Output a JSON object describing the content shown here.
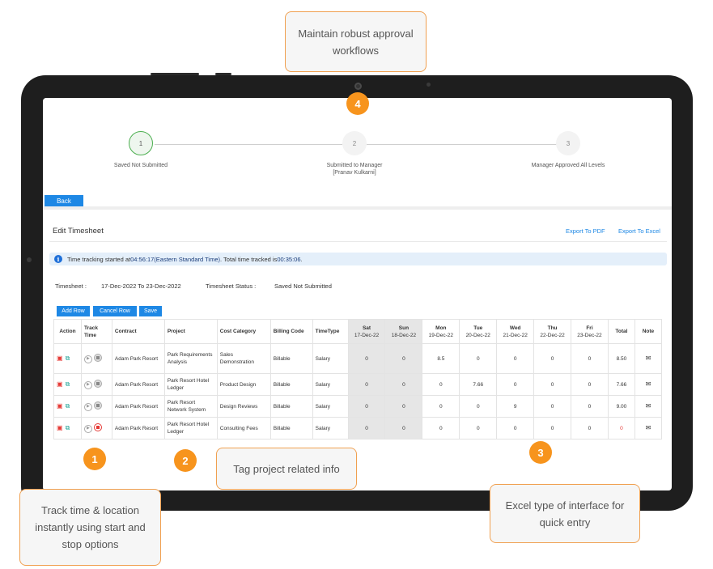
{
  "callouts": {
    "top": "Maintain robust approval workflows",
    "tag": "Tag project related info",
    "excel": "Excel type of interface for quick entry",
    "track": "Track time & location instantly using start and stop options"
  },
  "markers": {
    "m1": "1",
    "m2": "2",
    "m3": "3",
    "m4": "4"
  },
  "colors": {
    "accent": "#1e88e5",
    "marker": "#f7941d",
    "callout_border": "#f0a050",
    "step_active": "#4caf50",
    "danger": "#e53935"
  },
  "stepper": {
    "steps": [
      {
        "num": "1",
        "label": "Saved Not Submitted"
      },
      {
        "num": "2",
        "label": "Submitted to Manager",
        "sublabel": "[Pranav Kulkarni]"
      },
      {
        "num": "3",
        "label": "Manager Approved All Levels"
      }
    ]
  },
  "back_label": "Back",
  "page_title": "Edit Timesheet",
  "exports": {
    "pdf": "Export To PDF",
    "excel": "Export To Excel"
  },
  "info": {
    "icon": "info-icon",
    "prefix": "Time tracking started at ",
    "time": "04:56:17(Eastern Standard Time)",
    "middle": ". Total time tracked is ",
    "total": "00:35:06",
    "suffix": "."
  },
  "timesheet": {
    "range_label": "Timesheet :",
    "range": "17-Dec-2022 To 23-Dec-2022",
    "status_label": "Timesheet Status :",
    "status": "Saved Not Submitted"
  },
  "buttons": {
    "add_row": "Add Row",
    "cancel_row": "Cancel Row",
    "save": "Save"
  },
  "table": {
    "headers": {
      "action": "Action",
      "track": "Track Time",
      "contract": "Contract",
      "project": "Project",
      "cost": "Cost Category",
      "billing": "Billing Code",
      "timetype": "TimeType",
      "total": "Total",
      "note": "Note"
    },
    "days": [
      {
        "day": "Sat",
        "date": "17-Dec-22"
      },
      {
        "day": "Sun",
        "date": "18-Dec-22"
      },
      {
        "day": "Mon",
        "date": "19-Dec-22"
      },
      {
        "day": "Tue",
        "date": "20-Dec-22"
      },
      {
        "day": "Wed",
        "date": "21-Dec-22"
      },
      {
        "day": "Thu",
        "date": "22-Dec-22"
      },
      {
        "day": "Fri",
        "date": "23-Dec-22"
      }
    ],
    "rows": [
      {
        "contract": "Adam Park Resort",
        "project": "Park Requirements Analysis",
        "cost": "Sales Demonstration",
        "billing": "Billable",
        "timetype": "Salary",
        "hours": [
          "0",
          "0",
          "8.5",
          "0",
          "0",
          "0",
          "0"
        ],
        "total": "8.50"
      },
      {
        "contract": "Adam Park Resort",
        "project": "Park Resort Hotel Ledger",
        "cost": "Product Design",
        "billing": "Billable",
        "timetype": "Salary",
        "hours": [
          "0",
          "0",
          "0",
          "7.66",
          "0",
          "0",
          "0"
        ],
        "total": "7.66"
      },
      {
        "contract": "Adam Park Resort",
        "project": "Park Resort Network System",
        "cost": "Design Reviews",
        "billing": "Billable",
        "timetype": "Salary",
        "hours": [
          "0",
          "0",
          "0",
          "0",
          "9",
          "0",
          "0"
        ],
        "total": "9.00"
      },
      {
        "contract": "Adam Park Resort",
        "project": "Park Resort Hotel Ledger",
        "cost": "Consulting Fees",
        "billing": "Billable",
        "timetype": "Salary",
        "hours": [
          "0",
          "0",
          "0",
          "0",
          "0",
          "0",
          "0"
        ],
        "total": "0"
      }
    ],
    "icons": {
      "delete": "delete-icon",
      "copy": "copy-icon",
      "play": "play-icon",
      "stop": "stop-icon",
      "note": "note-icon"
    }
  }
}
